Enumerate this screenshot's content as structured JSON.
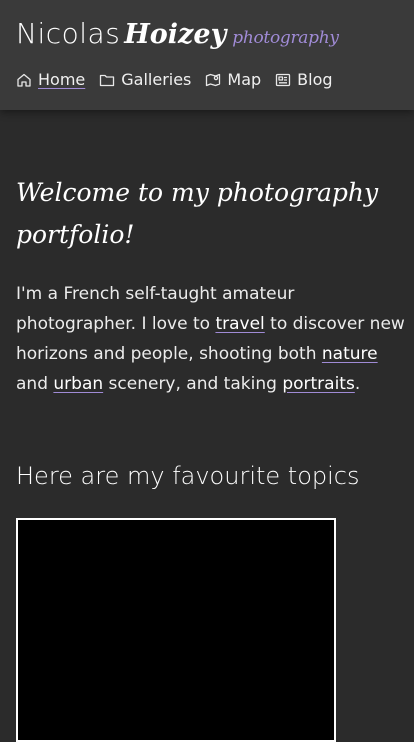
{
  "brand": {
    "first_name": "Nicolas",
    "last_name": "Hoizey",
    "tagline": "photography"
  },
  "nav": {
    "items": [
      {
        "label": "Home",
        "icon": "home-icon",
        "active": true
      },
      {
        "label": "Galleries",
        "icon": "folder-icon",
        "active": false
      },
      {
        "label": "Map",
        "icon": "map-icon",
        "active": false
      },
      {
        "label": "Blog",
        "icon": "newspaper-icon",
        "active": false
      }
    ]
  },
  "main": {
    "welcome_title": "Welcome to my photography portfolio!",
    "intro": {
      "t1": "I'm a French self-taught amateur photographer. I love to ",
      "link_travel": "travel",
      "t2": " to discover new horizons and people, shooting both ",
      "link_nature": "nature",
      "t3": " and ",
      "link_urban": "urban",
      "t4": " scenery, and taking ",
      "link_portraits": "portraits",
      "t5": "."
    },
    "topics_title": "Here are my favourite topics"
  },
  "colors": {
    "background": "#2b2b2b",
    "header": "#3a3a3a",
    "accent": "#a08bd6",
    "text": "#ececec"
  }
}
